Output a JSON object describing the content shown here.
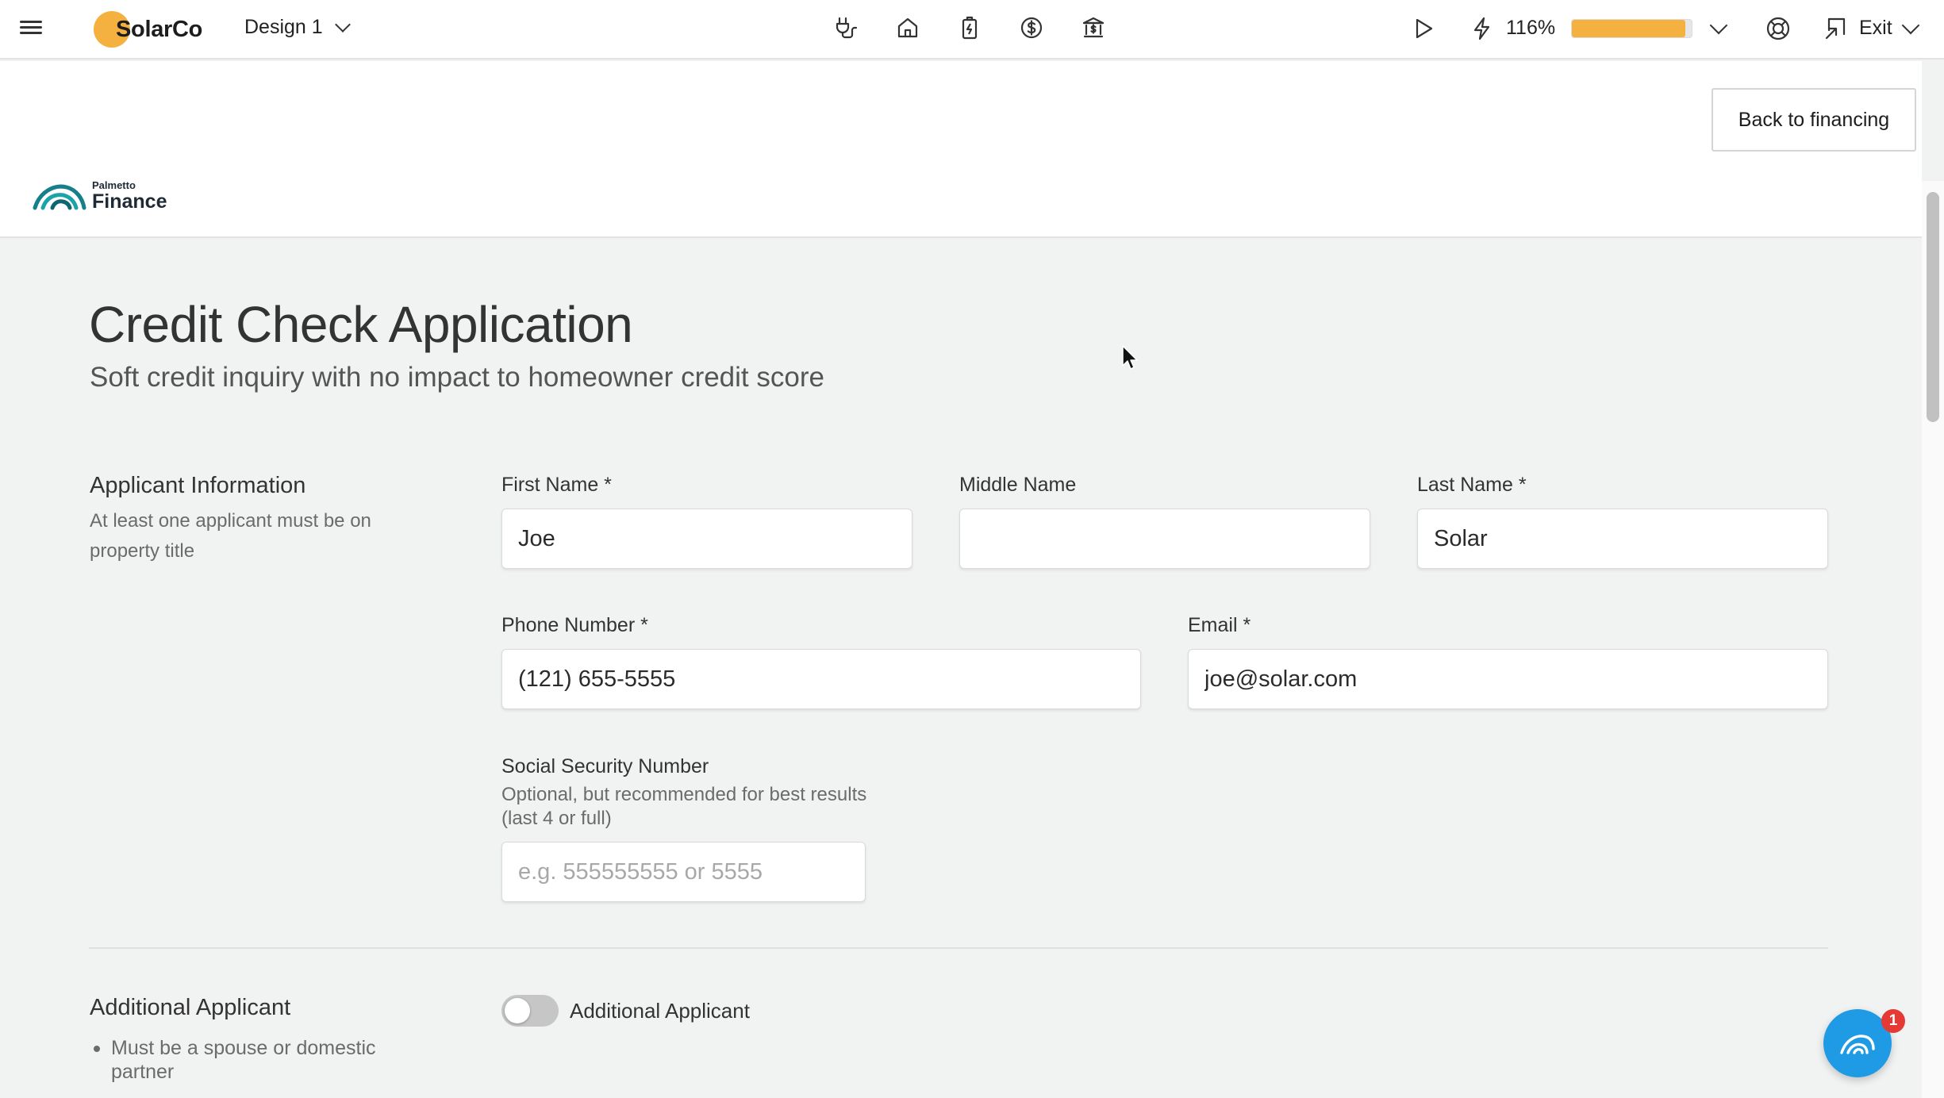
{
  "topbar": {
    "brand": "SolarCo",
    "design_label": "Design 1",
    "tools": [
      "plug-icon",
      "home-icon",
      "battery-icon",
      "dollar-icon",
      "bank-icon"
    ],
    "production_percent": "116%",
    "production_fill": 0.95,
    "exit_label": "Exit",
    "accent": "#f4b13f"
  },
  "header": {
    "back_button": "Back to financing",
    "partner_small": "Palmetto",
    "partner_big": "Finance"
  },
  "page": {
    "title": "Credit Check Application",
    "subtitle": "Soft credit inquiry with no impact to homeowner credit score"
  },
  "applicant": {
    "section_title": "Applicant Information",
    "section_desc": "At least one applicant must be on property title",
    "first_name_label": "First Name *",
    "first_name_value": "Joe",
    "middle_name_label": "Middle Name",
    "middle_name_value": "",
    "last_name_label": "Last Name *",
    "last_name_value": "Solar",
    "phone_label": "Phone Number *",
    "phone_value": "(121) 655-5555",
    "email_label": "Email *",
    "email_value": "joe@solar.com",
    "ssn_label": "Social Security Number",
    "ssn_help": "Optional, but recommended for best results (last 4 or full)",
    "ssn_placeholder": "e.g. 555555555 or 5555"
  },
  "additional": {
    "section_title": "Additional Applicant",
    "bullet": "Must be a spouse or domestic partner",
    "toggle_label": "Additional Applicant",
    "toggle_on": false
  },
  "chat": {
    "badge_count": "1",
    "color": "#1e9be4"
  }
}
